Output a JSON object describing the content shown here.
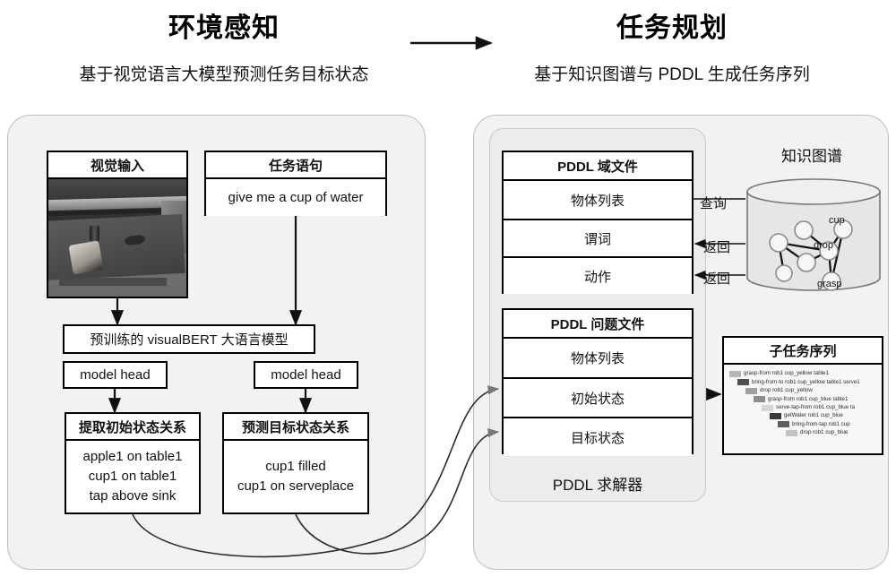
{
  "headers": {
    "left_title": "环境感知",
    "left_subtitle": "基于视觉语言大模型预测任务目标状态",
    "right_title": "任务规划",
    "right_subtitle": "基于知识图谱与 PDDL 生成任务序列"
  },
  "left_panel": {
    "visual_input": {
      "title": "视觉输入",
      "image_alt": "tabletop-scene-photo"
    },
    "task_sentence": {
      "title": "任务语句",
      "value": "give me a cup of water"
    },
    "model": {
      "title": "预训练的 visualBERT 大语言模型",
      "head_left": "model head",
      "head_right": "model head"
    },
    "initial_state": {
      "title": "提取初始状态关系",
      "lines": [
        "apple1 on table1",
        "cup1 on table1",
        "tap above sink"
      ]
    },
    "goal_state": {
      "title": "预测目标状态关系",
      "lines": [
        "cup1 filled",
        "cup1 on serveplace"
      ]
    }
  },
  "right_panel": {
    "solver_label": "PDDL 求解器",
    "domain_file": {
      "title": "PDDL 域文件",
      "rows": [
        "物体列表",
        "谓词",
        "动作"
      ]
    },
    "problem_file": {
      "title": "PDDL 问题文件",
      "rows": [
        "物体列表",
        "初始状态",
        "目标状态"
      ]
    },
    "edge_labels": [
      "查询",
      "返回",
      "返回"
    ],
    "knowledge_graph": {
      "title": "知识图谱",
      "node_labels": [
        "cup",
        "drop",
        "grasp"
      ]
    },
    "subtask_sequence": {
      "title": "子任务序列",
      "items": [
        {
          "label": "grasp-from rob1 cup_yellow table1",
          "indent": 0,
          "color": "#b5b5b5"
        },
        {
          "label": "bring-from-to rob1 cup_yellow table1 serve1",
          "indent": 1,
          "color": "#4f4f4f"
        },
        {
          "label": "drop rob1 cup_yellow",
          "indent": 2,
          "color": "#a0a0a0"
        },
        {
          "label": "grasp-from rob1 cup_blue table1",
          "indent": 3,
          "color": "#8c8c8c"
        },
        {
          "label": "serve-tap-from rob1 cup_blue ta",
          "indent": 4,
          "color": "#d6d6d6"
        },
        {
          "label": "getWater rob1 cup_blue",
          "indent": 5,
          "color": "#3a3a3a"
        },
        {
          "label": "bring-from-tap rob1 cup",
          "indent": 6,
          "color": "#5e5e5e"
        },
        {
          "label": "drop rob1 cup_blue",
          "indent": 7,
          "color": "#c2c2c2"
        }
      ]
    }
  },
  "colors": {
    "panel_bg": "#f2f2f2",
    "subpanel_bg": "#ececec",
    "box_border": "#000000",
    "arrow": "#1a1a1a",
    "curve_arrow": "#6e6e6e",
    "cylinder_fill": "#e6e6e6"
  }
}
